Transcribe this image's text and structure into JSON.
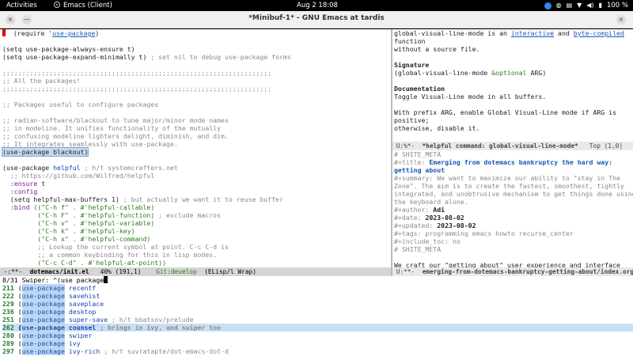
{
  "topbar": {
    "activities": "Activities",
    "app": "Emacs (Client)",
    "clock": "Aug 2  18:08",
    "battery": "100 %"
  },
  "window": {
    "title": "*Minibuf-1* - GNU Emacs at tardis",
    "close": "×",
    "min": "—",
    "max": "×"
  },
  "left": {
    "l1a": "  (require '",
    "l1b": "use-package",
    "l1c": ")",
    "l3": "(setq use-package-always-ensure t)",
    "l4a": "(setq use-package-expand-minimally t) ",
    "l4b": "; set nil to debug use-package forms",
    "l6": ";;;;;;;;;;;;;;;;;;;;;;;;;;;;;;;;;;;;;;;;;;;;;;;;;;;;;;;;;;;;;;;;;;;;;",
    "l7": ";; All the packages!",
    "l8": ";;;;;;;;;;;;;;;;;;;;;;;;;;;;;;;;;;;;;;;;;;;;;;;;;;;;;;;;;;;;;;;;;;;;;",
    "l10": ";; Packages useful to configure packages",
    "l12": ";; radian-software/blackout to tune major/minor mode names",
    "l13": ";; in modeline. It unifies functionality of the mutually",
    "l14": ";; confusing modeline lighters delight, diminish, and dim.",
    "l15": ";; It integrates seamlessly with use-package.",
    "l16": "(use-package blackout)",
    "l18a": "(use-package ",
    "l18b": "helpful",
    "l18c": " ; h/t systemcrafters.net",
    "l19": "  ;; https://github.com/Wilfred/helpful",
    "l20a": "  :ensure",
    "l20b": " t",
    "l21": "  :config",
    "l22a": "  (setq helpful-max-buffers 1) ",
    "l22b": "; but actually we want it to reuse buffer",
    "l23a": "  :bind",
    "l23b": " ((\"C-h f\" . #'helpful-callable)",
    "l24a": "         (\"C-h F\" . #'helpful-function) ",
    "l24b": "; exclude macros",
    "l25": "         (\"C-h v\" . #'helpful-variable)",
    "l26": "         (\"C-h k\" . #'helpful-key)",
    "l27": "         (\"C-h x\" . #'helpful-command)",
    "l28": "         ;; Lookup the current symbol at point. C-c C-d is",
    "l29": "         ;; a common keybinding for this in lisp modes.",
    "l30": "         (\"C-c C-d\" . #'helpful-at-point))"
  },
  "right_top": {
    "r1a": "global-visual-line-mode",
    "r1b": " is an ",
    "r1c": "interactive",
    "r1d": " and ",
    "r1e": "byte-compiled",
    "r2": "function",
    "r3": "without a source file.",
    "r5": "Signature",
    "r6a": "(global-visual-line-mode ",
    "r6b": "&optional",
    "r6c": " ARG)",
    "r8": "Documentation",
    "r9": "Toggle Visual-Line mode in all buffers.",
    "r11": "With prefix ARG, enable Global Visual-Line mode if ARG is",
    "r12": "positive;",
    "r13": "otherwise, disable it."
  },
  "right_bottom": {
    "b1": "# SHITE_META",
    "b2a": "#+title: ",
    "b2b": "Emerging from dotemacs bankruptcy the hard way:",
    "b3": "getting about",
    "b4": "#+summary: We want to maximize our ability to \"stay in The",
    "b5": "Zone\". The aim is to create the fastest, smoothest, tightly",
    "b6": "integrated, and unobtrusive mechanism to get things done using",
    "b7": "the keyboard alone.",
    "b8a": "#+author: ",
    "b8b": "Adi",
    "b9a": "#+date: ",
    "b9b": "2023-08-02",
    "b10a": "#+updated: ",
    "b10b": "2023-08-02",
    "b11": "#+tags: programming emacs howto recurse_center",
    "b12": "#+include_toc: no",
    "b13": "# SHITE_META",
    "b15": "We craft our \"getting about\" user experience and interface"
  },
  "modelines": {
    "left_a": " -:**-  ",
    "left_b": "dotemacs/init.el",
    "left_c": "   40% (191,1)    ",
    "left_d": "Git:develop",
    "left_e": "  (ELisp/l Wrap)",
    "rt_a": " U:%*-  ",
    "rt_b": "*helpful command: global-visual-line-mode*",
    "rt_c": "   Top (1,0)",
    "rb_a": " U:**-  ",
    "rb_b": "emerging-from-dotemacs-bankruptcy-getting-about/index.org"
  },
  "minibuffer": {
    "prompt": "8/31 Swiper: ",
    "input": "^(use package",
    "items": [
      {
        "num": "211",
        "rest": " recentf",
        "comment": ""
      },
      {
        "num": "222",
        "rest": " savehist",
        "comment": ""
      },
      {
        "num": "229",
        "rest": " saveplace",
        "comment": ""
      },
      {
        "num": "236",
        "rest": " desktop",
        "comment": ""
      },
      {
        "num": "251",
        "rest": " super-save",
        "comment": " ; h/t bbatsov/prelude"
      },
      {
        "num": "262",
        "rest": " counsel",
        "comment": " ; brings in ivy, and swiper too"
      },
      {
        "num": "280",
        "rest": " swiper",
        "comment": ""
      },
      {
        "num": "289",
        "rest": " ivy",
        "comment": ""
      },
      {
        "num": "297",
        "rest": " ivy-rich",
        "comment": " ; h/t suvratapte/dot-emacs-dot-d"
      }
    ],
    "open": "(",
    "pkg": "use-package"
  }
}
